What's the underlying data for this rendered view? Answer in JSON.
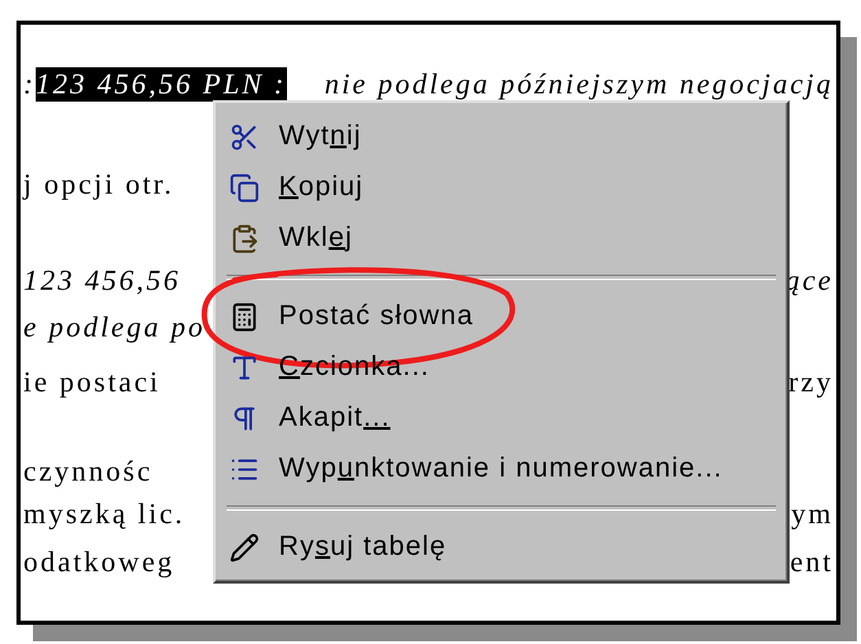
{
  "document": {
    "lines": [
      {
        "left": ":",
        "selected": "123 456,56 PLN :",
        "right": "nie podlega późniejszym negocjacją",
        "italic": true
      },
      {
        "left": "j opcji otr.",
        "italic": false
      },
      {
        "left": "123 456,56",
        "right": "ące",
        "italic": true
      },
      {
        "left": "e podlega po",
        "italic": true
      },
      {
        "left": "ie postaci",
        "right": "rzy",
        "italic": false
      },
      {
        "left": "czynnośc",
        "italic": false
      },
      {
        "left": "myszką lic.",
        "right": "ym",
        "italic": false
      },
      {
        "left": "odatkoweg",
        "right": "ent",
        "italic": false
      }
    ]
  },
  "context_menu": {
    "items": [
      {
        "kind": "item",
        "label": [
          {
            "text": "Wyt"
          },
          {
            "text": "n",
            "key": true
          },
          {
            "text": "ij"
          }
        ]
      },
      {
        "kind": "item",
        "label": [
          {
            "text": "K",
            "key": true
          },
          {
            "text": "opiuj"
          }
        ]
      },
      {
        "kind": "item",
        "label": [
          {
            "text": "Wkl"
          },
          {
            "text": "e",
            "key": true
          },
          {
            "text": "j"
          }
        ]
      },
      {
        "kind": "separator"
      },
      {
        "kind": "item",
        "label": [
          {
            "text": "Postać słowna"
          }
        ],
        "circled": true
      },
      {
        "kind": "item",
        "label": [
          {
            "text": "C",
            "key": true
          },
          {
            "text": "zcionka..."
          }
        ]
      },
      {
        "kind": "item",
        "label": [
          {
            "text": "Akapit"
          },
          {
            "text": "...",
            "key": true
          }
        ]
      },
      {
        "kind": "item",
        "label": [
          {
            "text": "Wyp"
          },
          {
            "text": "u",
            "key": true
          },
          {
            "text": "nktowanie i numerowanie..."
          }
        ]
      },
      {
        "kind": "separator"
      },
      {
        "kind": "item",
        "label": [
          {
            "text": "Ry"
          },
          {
            "text": "s",
            "key": true
          },
          {
            "text": "uj tabelę"
          }
        ]
      }
    ]
  }
}
